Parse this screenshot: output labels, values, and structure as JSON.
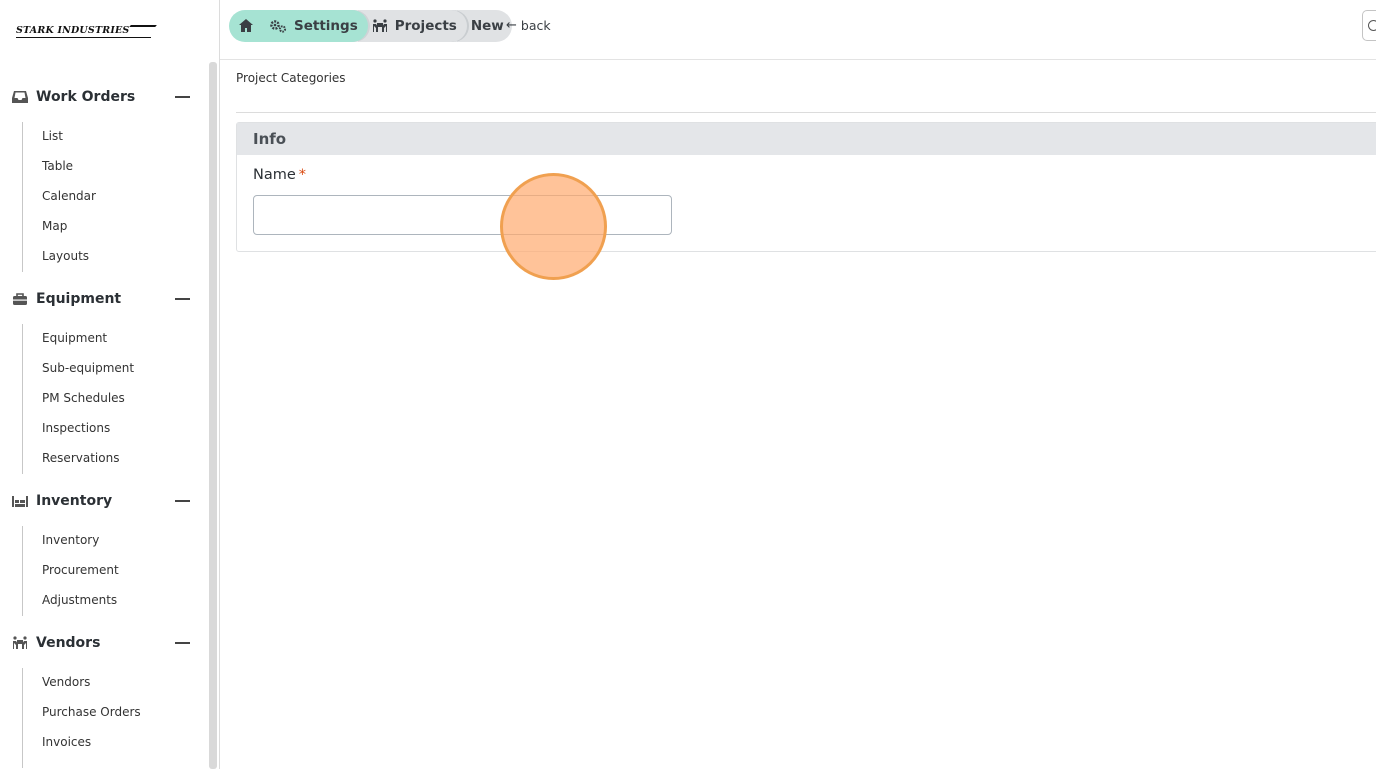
{
  "brand": {
    "logo_text": "STARK INDUSTRIES"
  },
  "topbar": {
    "breadcrumbs": [
      {
        "label": "",
        "icon": "home-icon"
      },
      {
        "label": "Settings",
        "icon": "gears-icon"
      },
      {
        "label": "Projects",
        "icon": "people-carry-icon"
      },
      {
        "label": "New"
      }
    ],
    "back_label": "back",
    "back_icon": "arrow-left-icon"
  },
  "sidebar": {
    "sections": [
      {
        "title": "Work Orders",
        "icon": "inbox-icon",
        "items": [
          "List",
          "Table",
          "Calendar",
          "Map",
          "Layouts"
        ]
      },
      {
        "title": "Equipment",
        "icon": "toolbox-icon",
        "items": [
          "Equipment",
          "Sub-equipment",
          "PM Schedules",
          "Inspections",
          "Reservations"
        ]
      },
      {
        "title": "Inventory",
        "icon": "warehouse-icon",
        "items": [
          "Inventory",
          "Procurement",
          "Adjustments"
        ]
      },
      {
        "title": "Vendors",
        "icon": "people-carry-icon",
        "items": [
          "Vendors",
          "Purchase Orders",
          "Invoices"
        ]
      }
    ]
  },
  "main": {
    "subtitle": "Project Categories",
    "card": {
      "title": "Info",
      "field_label": "Name",
      "required_mark": "*",
      "name_value": ""
    }
  },
  "colors": {
    "breadcrumb_active": "#a6e3d3",
    "breadcrumb_inactive": "#e0e2e4",
    "required": "#d9480f",
    "cursor_highlight": "#f0a050"
  }
}
